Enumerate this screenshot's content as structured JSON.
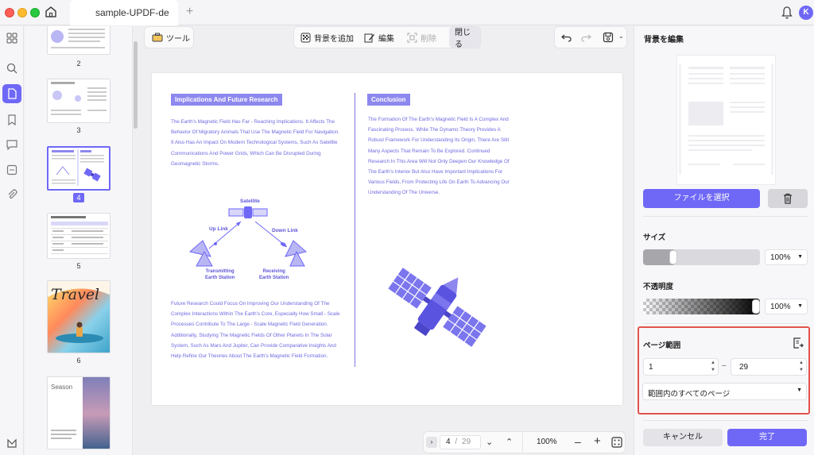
{
  "window": {
    "tab_title": "sample-UPDF-de",
    "avatar_letter": "K"
  },
  "toolbar": {
    "tools_label": "ツール",
    "add_background": "背景を追加",
    "edit": "編集",
    "delete": "削除",
    "close": "閉じる"
  },
  "thumbnails": [
    {
      "num": "2"
    },
    {
      "num": "3"
    },
    {
      "num": "4"
    },
    {
      "num": "5"
    },
    {
      "num": "6"
    },
    {
      "num": ""
    }
  ],
  "thumb_texts": {
    "travel": "Travel",
    "season": "Season"
  },
  "document": {
    "left_heading": "Implications And Future Research",
    "left_para1": "The Earth's Magnetic Field Has Far - Reaching Implications. It Affects The Behavior Of Migratory Animals That Use The Magnetic Field For Navigation. It Also Has An Impact On Modern Technological Systems, Such As Satellite Communications And Power Grids, Which Can Be Disrupted During Geomagnetic Storms.",
    "diagram": {
      "satellite": "Satellite",
      "uplink": "Up Link",
      "downlink": "Down Link",
      "transmitting": "Transmitting",
      "transmitting2": "Earth Station",
      "receiving": "Receiving",
      "receiving2": "Earth Station"
    },
    "left_para2": "Future Research Could Focus On Improving Our Understanding Of The Complex Interactions Within The Earth's Core, Especially How Small - Scale Processes Contribute To The Large - Scale Magnetic Field Generation. Additionally, Studying The Magnetic Fields Of Other Planets In The Solar System, Such As Mars And Jupiter, Can Provide Comparative Insights And Help Refine Our Theories About The Earth's Magnetic Field Formation.",
    "right_heading": "Conclusion",
    "right_para": "The Formation Of The Earth's Magnetic Field Is A Complex And Fascinating Process. While The Dynamo Theory Provides A Robust Framework For Understanding Its Origin, There Are Still Many Aspects That Remain To Be Explored. Continued Research In This Area Will Not Only Deepen Our Knowledge Of The Earth's Interior But Also Have Important Implications For Various Fields, From Protecting Life On Earth To Advancing Our Understanding Of The Universe."
  },
  "pagination": {
    "current": "4",
    "separator": "/",
    "total": "29",
    "zoom": "100%"
  },
  "right_panel": {
    "title": "背景を編集",
    "select_file": "ファイルを選択",
    "size_label": "サイズ",
    "size_value": "100%",
    "size_level": 0.24,
    "opacity_label": "不透明度",
    "opacity_value": "100%",
    "opacity_level": 1.0,
    "page_range_label": "ページ範囲",
    "range_from": "1",
    "range_dash": "–",
    "range_to": "29",
    "range_option": "範囲内のすべてのページ",
    "cancel": "キャンセル",
    "done": "完了"
  },
  "colors": {
    "accent": "#6f68f6",
    "doc_text": "#6f68e0",
    "highlight_border": "#e2534c"
  }
}
